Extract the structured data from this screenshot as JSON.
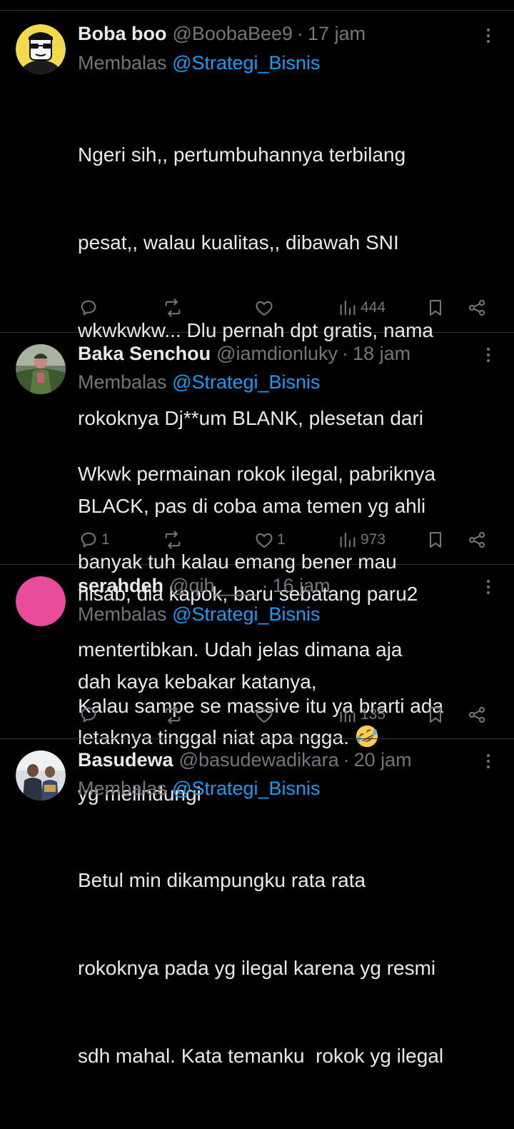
{
  "colors": {
    "background": "#000000",
    "primary_text": "#e7e9ea",
    "secondary_text": "#71767b",
    "link": "#1d9bf0",
    "divider": "#2f3336"
  },
  "tweets": [
    {
      "name": "Boba boo",
      "handle": "@BoobaBee9",
      "separator": "·",
      "time": "17 jam",
      "reply_prefix": "Membalas",
      "reply_to": "@Strategi_Bisnis",
      "lines": [
        "Ngeri sih,, pertumbuhannya terbilang",
        "pesat,, walau kualitas,, dibawah SNI",
        "wkwkwkw... Dlu pernah dpt gratis, nama",
        "rokoknya Dj**um BLANK, plesetan dari",
        "BLACK, pas di coba ama temen yg ahli",
        "hisab, dia kapok, baru sebatang paru2",
        "dah kaya kebakar katanya,"
      ],
      "replies": "",
      "reposts": "",
      "likes": "",
      "views": "444",
      "avatar_icon": "cartoon-sunglasses-avatar"
    },
    {
      "name": "Baka Senchou",
      "handle": "@iamdionluky",
      "separator": "·",
      "time": "18 jam",
      "reply_prefix": "Membalas",
      "reply_to": "@Strategi_Bisnis",
      "lines": [
        "Wkwk permainan rokok ilegal, pabriknya",
        "banyak tuh kalau emang bener mau",
        "mentertibkan. Udah jelas dimana aja",
        "letaknya tinggal niat apa ngga."
      ],
      "emoji": "rolling-on-the-floor-laughing-emoji",
      "replies": "1",
      "reposts": "",
      "likes": "1",
      "views": "973",
      "avatar_icon": "soldier-photo-avatar"
    },
    {
      "name": "serahdeh",
      "handle": "@qih____",
      "separator": "·",
      "time": "16 jam",
      "reply_prefix": "Membalas",
      "reply_to": "@Strategi_Bisnis",
      "lines": [
        "Kalau sampe se massive itu ya brarti ada",
        "yg melindungi"
      ],
      "replies": "",
      "reposts": "",
      "likes": "",
      "views": "135",
      "avatar_icon": "pink-circle-avatar"
    },
    {
      "name": "Basudewa",
      "handle": "@basudewadikara",
      "separator": "·",
      "time": "20 jam",
      "reply_prefix": "Membalas",
      "reply_to": "@Strategi_Bisnis",
      "lines": [
        "Betul min dikampungku rata rata",
        "rokoknya pada yg ilegal karena yg resmi",
        "sdh mahal. Kata temanku  rokok yg ilegal"
      ],
      "avatar_icon": "group-photo-avatar"
    }
  ]
}
